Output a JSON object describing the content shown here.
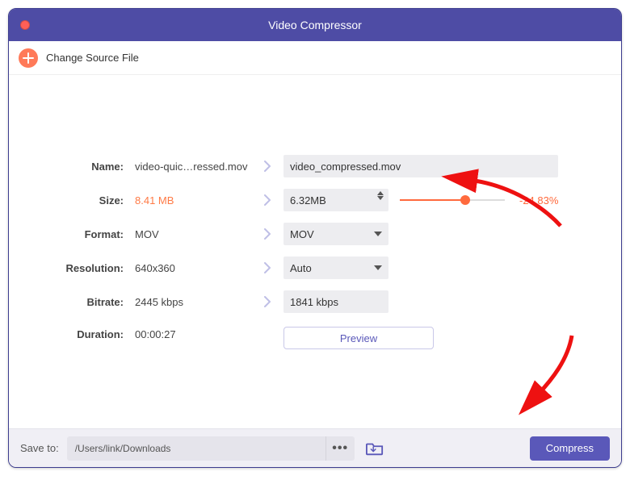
{
  "window": {
    "title": "Video Compressor"
  },
  "toolbar": {
    "change_source_label": "Change Source File"
  },
  "rows": {
    "name": {
      "label": "Name:",
      "src": "video-quic…ressed.mov",
      "out": "video_compressed.mov"
    },
    "size": {
      "label": "Size:",
      "src": "8.41 MB",
      "out": "6.32MB",
      "percent": "-24.83%"
    },
    "format": {
      "label": "Format:",
      "src": "MOV",
      "out": "MOV"
    },
    "resolution": {
      "label": "Resolution:",
      "src": "640x360",
      "out": "Auto"
    },
    "bitrate": {
      "label": "Bitrate:",
      "src": "2445 kbps",
      "out": "1841 kbps"
    },
    "duration": {
      "label": "Duration:",
      "src": "00:00:27"
    }
  },
  "preview": {
    "label": "Preview"
  },
  "footer": {
    "save_label": "Save to:",
    "path": "/Users/link/Downloads",
    "compress_label": "Compress"
  }
}
